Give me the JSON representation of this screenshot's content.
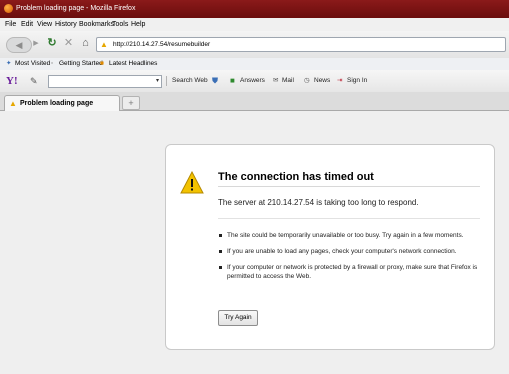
{
  "window": {
    "title": "Problem loading page - Mozilla Firefox"
  },
  "menu": [
    "File",
    "Edit",
    "View",
    "History",
    "Bookmarks",
    "Tools",
    "Help"
  ],
  "nav": {
    "url": "http://210.14.27.54/resumebuilder"
  },
  "bookmarks": [
    "Most Visited",
    "Getting Started",
    "Latest Headlines"
  ],
  "yahoo_toolbar": {
    "logo": "Y!",
    "items": [
      "Search Web",
      "Answers",
      "Mail",
      "News",
      "Sign In"
    ]
  },
  "tabs": [
    {
      "label": "Problem loading page"
    }
  ],
  "error": {
    "title": "The connection has timed out",
    "description": "The server at 210.14.27.54 is taking too long to respond.",
    "reasons": [
      "The site could be temporarily unavailable or too busy. Try again in a few moments.",
      "If you are unable to load any pages, check your computer's network connection.",
      "If your computer or network is protected by a firewall or proxy, make sure that Firefox is permitted to access the Web."
    ],
    "button": "Try Again"
  },
  "colors": {
    "titlebar": "#7a1414",
    "warning": "#e6a700",
    "yahoo": "#6b1f9c"
  }
}
